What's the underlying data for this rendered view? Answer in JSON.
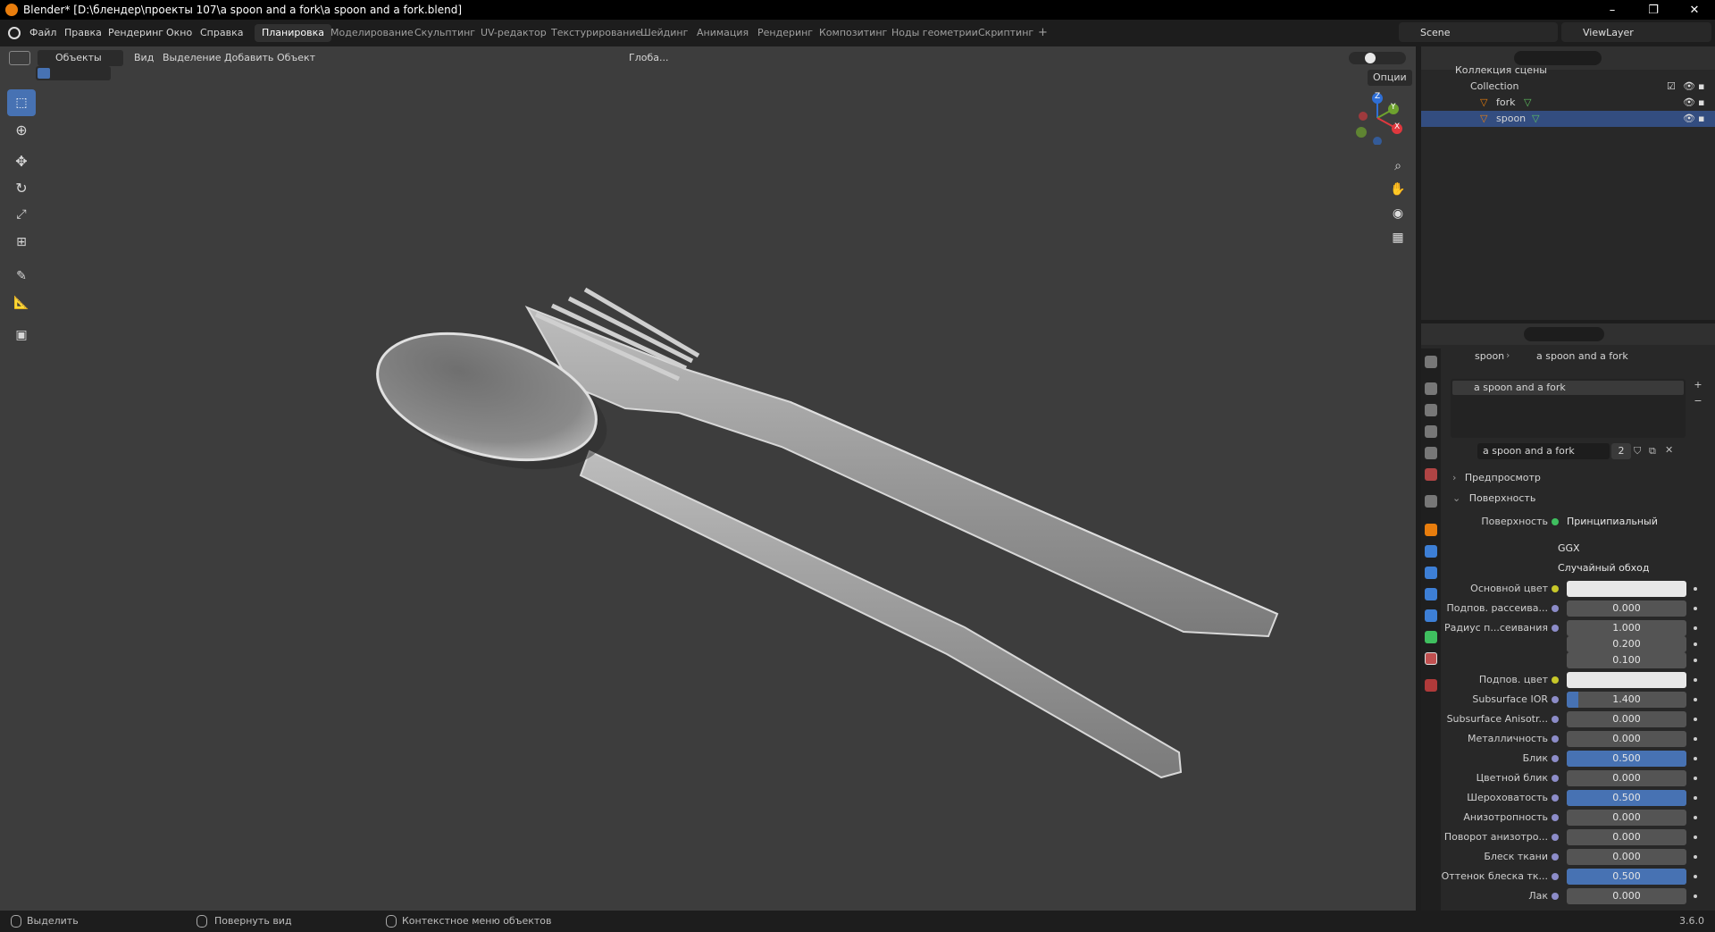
{
  "window": {
    "title": "Blender* [D:\\блендер\\проекты 107\\a spoon and a fork\\a spoon and a fork.blend]",
    "controls": [
      "–",
      "❐",
      "✕"
    ]
  },
  "menu": [
    "Файл",
    "Правка",
    "Рендеринг",
    "Окно",
    "Справка"
  ],
  "workspaces": [
    "Планировка",
    "Моделирование",
    "Скульптинг",
    "UV-редактор",
    "Текстурирование",
    "Шейдинг",
    "Анимация",
    "Рендеринг",
    "Композитинг",
    "Ноды геометрии",
    "Скриптинг",
    "+"
  ],
  "active_workspace": "Планировка",
  "scene_selector": "Scene",
  "viewlayer_selector": "ViewLayer",
  "viewport_header": {
    "mode": "Объекты",
    "menus": [
      "Вид",
      "Выделение",
      "Добавить",
      "Объект"
    ],
    "transform_orientation": "Глоба...",
    "options": "Опции"
  },
  "gizmo": {
    "z": "Z",
    "y": "Y",
    "x": "X"
  },
  "outliner": {
    "root": "Коллекция сцены",
    "collection": "Collection",
    "objects": [
      "fork",
      "spoon"
    ]
  },
  "properties": {
    "breadcrumb_object": "spoon",
    "breadcrumb_material": "a spoon and a fork",
    "material_slot": "a spoon and a fork",
    "material_name": "a spoon and a fork",
    "user_count": "2",
    "section_preview": "Предпросмотр",
    "section_surface": "Поверхность",
    "surface_label": "Поверхность",
    "surface_value": "Принципиальный BSDF",
    "distribution": "GGX",
    "subsurface_method": "Случайный обход",
    "rows": [
      {
        "label": "Основной цвет",
        "type": "color",
        "value": ""
      },
      {
        "label": "Подпов. рассеива...",
        "type": "num",
        "value": "0.000",
        "fill": 0
      },
      {
        "label": "Радиус п...сеивания",
        "type": "num",
        "value": "1.000",
        "fill": 0
      },
      {
        "label": "",
        "type": "num",
        "value": "0.200",
        "fill": 0
      },
      {
        "label": "",
        "type": "num",
        "value": "0.100",
        "fill": 0
      },
      {
        "label": "Подпов. цвет",
        "type": "color",
        "value": ""
      },
      {
        "label": "Subsurface IOR",
        "type": "num",
        "value": "1.400",
        "fill": 0.1
      },
      {
        "label": "Subsurface Anisotr...",
        "type": "num",
        "value": "0.000",
        "fill": 0
      },
      {
        "label": "Металличность",
        "type": "num",
        "value": "0.000",
        "fill": 0
      },
      {
        "label": "Блик",
        "type": "num",
        "value": "0.500",
        "fill": 1
      },
      {
        "label": "Цветной блик",
        "type": "num",
        "value": "0.000",
        "fill": 0
      },
      {
        "label": "Шероховатость",
        "type": "num",
        "value": "0.500",
        "fill": 1
      },
      {
        "label": "Анизотропность",
        "type": "num",
        "value": "0.000",
        "fill": 0
      },
      {
        "label": "Поворот анизотро...",
        "type": "num",
        "value": "0.000",
        "fill": 0
      },
      {
        "label": "Блеск ткани",
        "type": "num",
        "value": "0.000",
        "fill": 0
      },
      {
        "label": "Оттенок блеска тк...",
        "type": "num",
        "value": "0.500",
        "fill": 1
      },
      {
        "label": "Лак",
        "type": "num",
        "value": "0.000",
        "fill": 0
      }
    ]
  },
  "statusbar": {
    "select": "Выделить",
    "rotate": "Повернуть вид",
    "context_menu": "Контекстное меню объектов",
    "version": "3.6.0"
  },
  "colors": {
    "accent": "#4772b3",
    "viewport_bg": "#3d3d3d",
    "panel_bg": "#282828",
    "blender_orange": "#e87d0d"
  }
}
